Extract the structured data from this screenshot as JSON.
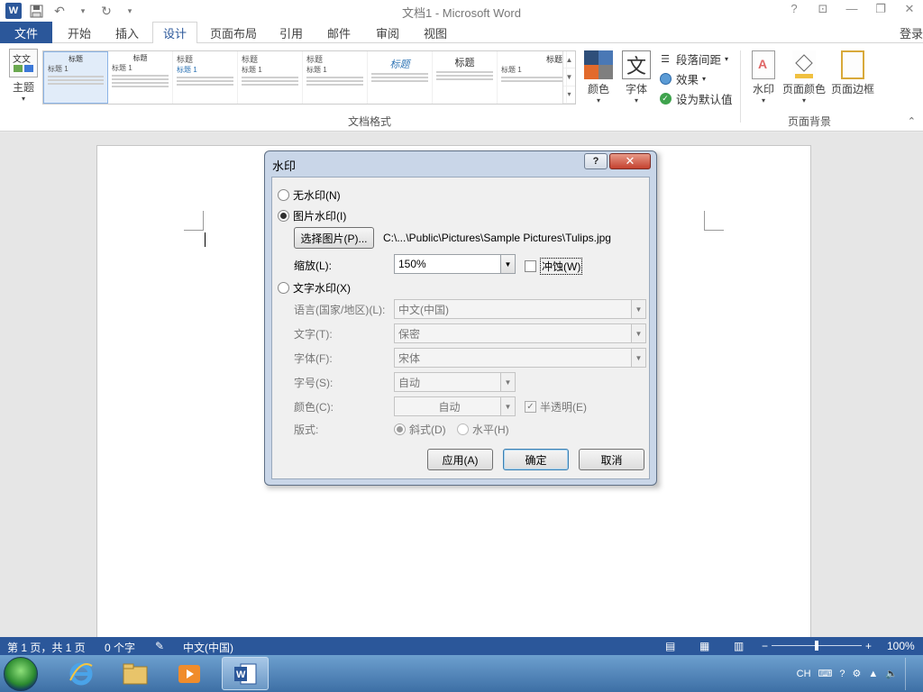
{
  "window": {
    "title": "文档1 - Microsoft Word",
    "controls": {
      "help": "?",
      "restore_ribbon": "⊡",
      "minimize": "—",
      "maximize": "❐",
      "close": "✕"
    }
  },
  "qat": {
    "app_icon": "W",
    "save_icon": "floppy-icon",
    "undo_icon": "undo-icon",
    "redo_icon": "redo-icon",
    "customize_icon": "customize-icon"
  },
  "tabs": {
    "file": "文件",
    "items": [
      "开始",
      "插入",
      "设计",
      "页面布局",
      "引用",
      "邮件",
      "审阅",
      "视图"
    ],
    "active": "设计",
    "login": "登录"
  },
  "ribbon": {
    "themes_label": "主题",
    "group_doc_format": "文档格式",
    "group_page_bg": "页面背景",
    "gallery": [
      {
        "title": "标题",
        "heading": "标题 1"
      },
      {
        "title": "标题",
        "heading": "标题 1"
      },
      {
        "title": "标题",
        "heading": "标题 1"
      },
      {
        "title": "标题",
        "heading": "标题 1"
      },
      {
        "title": "标题",
        "heading": "标题 1"
      },
      {
        "title": "标题",
        "heading": ""
      },
      {
        "title": "标题",
        "heading": ""
      },
      {
        "title": "标题",
        "heading": "标题 1"
      }
    ],
    "colors_label": "颜色",
    "fonts_label": "字体",
    "font_glyph": "文",
    "para_spacing": "段落间距",
    "effects": "效果",
    "set_default": "设为默认值",
    "watermark_label": "水印",
    "page_color_label": "页面颜色",
    "page_border_label": "页面边框",
    "accent_color": "#2b579a"
  },
  "dialog": {
    "title": "水印",
    "help_glyph": "?",
    "close_glyph": "✕",
    "no_watermark": "无水印(N)",
    "picture_watermark": "图片水印(I)",
    "select_picture": "选择图片(P)...",
    "picture_path": "C:\\...\\Public\\Pictures\\Sample Pictures\\Tulips.jpg",
    "scale_label": "缩放(L):",
    "scale_value": "150%",
    "washout": "冲蚀(W)",
    "text_watermark": "文字水印(X)",
    "language_label": "语言(国家/地区)(L):",
    "language_value": "中文(中国)",
    "text_label": "文字(T):",
    "text_value": "保密",
    "font_label": "字体(F):",
    "font_value": "宋体",
    "size_label": "字号(S):",
    "size_value": "自动",
    "color_label": "颜色(C):",
    "color_value": "自动",
    "semitransparent": "半透明(E)",
    "layout_label": "版式:",
    "diagonal": "斜式(D)",
    "horizontal": "水平(H)",
    "apply": "应用(A)",
    "ok": "确定",
    "cancel": "取消",
    "selected_option": "picture_watermark"
  },
  "statusbar": {
    "page": "第 1 页，共 1 页",
    "words": "0 个字",
    "language": "中文(中国)",
    "zoom": "100%",
    "zoom_minus": "−",
    "zoom_plus": "+"
  },
  "taskbar": {
    "apps": [
      "ie-icon",
      "explorer-icon",
      "media-player-icon",
      "word-icon"
    ],
    "ime": "CH"
  }
}
